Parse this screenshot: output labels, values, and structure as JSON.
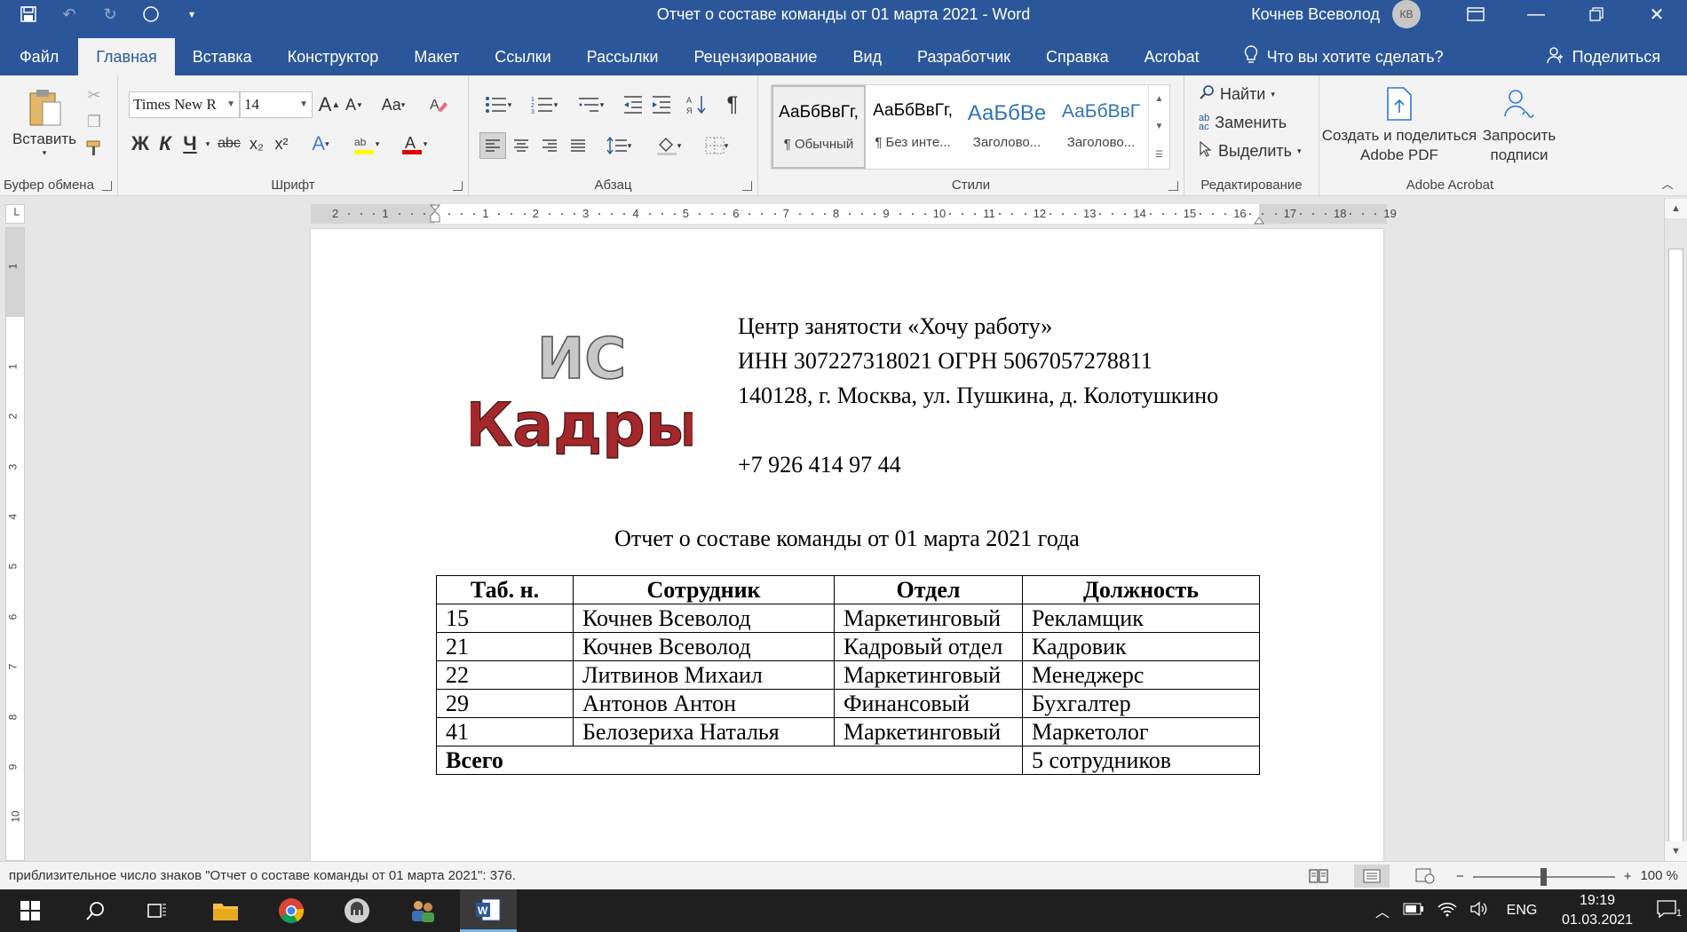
{
  "window": {
    "title": "Отчет о составе команды от 01 марта 2021  -  Word",
    "user_name": "Кочнев Всеволод",
    "user_initials": "КВ"
  },
  "tabs": [
    "Файл",
    "Главная",
    "Вставка",
    "Конструктор",
    "Макет",
    "Ссылки",
    "Рассылки",
    "Рецензирование",
    "Вид",
    "Разработчик",
    "Справка",
    "Acrobat"
  ],
  "active_tab": "Главная",
  "tell_me": "Что вы хотите сделать?",
  "share": "Поделиться",
  "ribbon": {
    "clipboard": {
      "paste": "Вставить",
      "label": "Буфер обмена"
    },
    "font": {
      "name": "Times New R",
      "size": "14",
      "label": "Шрифт",
      "bold": "Ж",
      "italic": "К",
      "underline": "Ч",
      "strike": "abc",
      "sub": "x₂",
      "sup": "x²",
      "grow": "A",
      "shrink": "A",
      "case": "Aa"
    },
    "paragraph": {
      "label": "Абзац",
      "pilcrow": "¶"
    },
    "styles": {
      "label": "Стили",
      "items": [
        {
          "sample": "АаБбВвГг,",
          "name": "¶ Обычный"
        },
        {
          "sample": "АаБбВвГг,",
          "name": "¶ Без инте..."
        },
        {
          "sample": "АаБбВе",
          "name": "Заголово..."
        },
        {
          "sample": "АаБбВвГ",
          "name": "Заголово..."
        }
      ]
    },
    "editing": {
      "find": "Найти",
      "replace": "Заменить",
      "select": "Выделить",
      "label": "Редактирование"
    },
    "acrobat": {
      "create": "Создать и поделиться Adobe PDF",
      "request": "Запросить подписи",
      "label": "Adobe Acrobat"
    }
  },
  "ruler": {
    "numbers": [
      "2",
      "1",
      "",
      "1",
      "2",
      "3",
      "4",
      "5",
      "6",
      "7",
      "8",
      "9",
      "10",
      "11",
      "12",
      "13",
      "14",
      "15",
      "16",
      "17",
      "18",
      "19"
    ],
    "vnumbers": [
      "1",
      "",
      "1",
      "2",
      "3",
      "4",
      "5",
      "6",
      "7",
      "8",
      "9",
      "10",
      "11"
    ]
  },
  "document": {
    "logo": {
      "line1": "ИС",
      "line2": "Кадры"
    },
    "company_lines": [
      "Центр занятости «Хочу работу»",
      "ИНН 307227318021 ОГРН 5067057278811",
      "140128, г. Москва, ул. Пушкина, д. Колотушкино",
      "",
      "+7 926 414 97 44"
    ],
    "report_title": "Отчет о составе команды от 01 марта 2021 года",
    "table": {
      "headers": [
        "Таб. н.",
        "Сотрудник",
        "Отдел",
        "Должность"
      ],
      "rows": [
        [
          "15",
          "Кочнев Всеволод",
          "Маркетинговый",
          "Рекламщик"
        ],
        [
          "21",
          "Кочнев Всеволод",
          "Кадровый отдел",
          "Кадровик"
        ],
        [
          "22",
          "Литвинов Михаил",
          "Маркетинговый",
          "Менеджерс"
        ],
        [
          "29",
          "Антонов Антон",
          "Финансовый",
          "Бухгалтер"
        ],
        [
          "41",
          "Белозериха Наталья",
          "Маркетинговый",
          "Маркетолог"
        ]
      ],
      "total_label": "Всего",
      "total_value": "5 сотрудников"
    }
  },
  "status": {
    "message": "приблизительное число знаков \"Отчет о составе команды от 01 марта 2021\": 376.",
    "zoom": "100 %"
  },
  "taskbar": {
    "time": "19:19",
    "date": "01.03.2021",
    "lang": "ENG",
    "notifications": "1"
  },
  "colors": {
    "word_blue": "#2b579a",
    "logo_red": "#a4282b",
    "logo_grey": "#c8c8c8"
  }
}
